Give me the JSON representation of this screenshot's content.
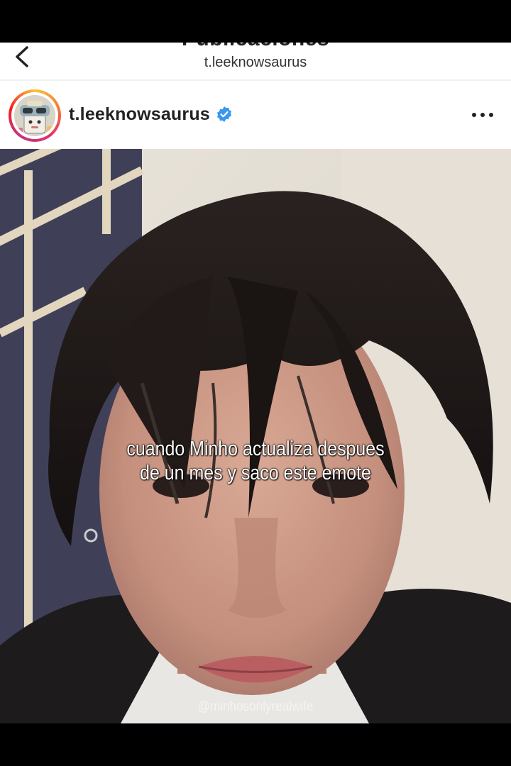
{
  "header": {
    "title": "Publicaciones",
    "subtitle": "t.leeknowsaurus",
    "back_icon": "chevron-left-icon"
  },
  "post": {
    "username": "t.leeknowsaurus",
    "verified": true,
    "verified_color": "#3897f0",
    "more_icon": "more-horizontal-icon",
    "avatar_ring_colors": [
      "#f9c33c",
      "#f77737",
      "#e1306c",
      "#c13584"
    ]
  },
  "overlay": {
    "caption_line1": "cuando Minho actualiza despues",
    "caption_line2": "de un mes y saco este emote",
    "watermark": "@minhosonlyrealwife"
  }
}
